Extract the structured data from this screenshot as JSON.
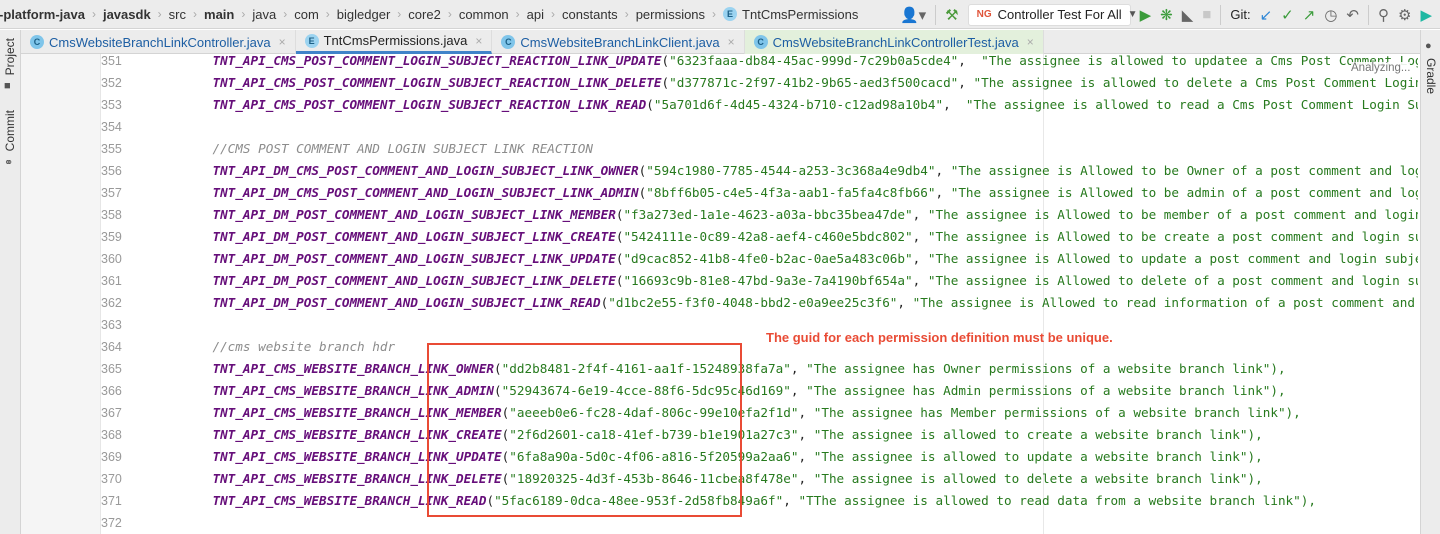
{
  "breadcrumb": [
    {
      "label": "-platform-java",
      "bold": true
    },
    {
      "label": "javasdk",
      "bold": true
    },
    {
      "label": "src"
    },
    {
      "label": "main",
      "bold": true
    },
    {
      "label": "java"
    },
    {
      "label": "com"
    },
    {
      "label": "bigledger"
    },
    {
      "label": "core2"
    },
    {
      "label": "common"
    },
    {
      "label": "api"
    },
    {
      "label": "constants"
    },
    {
      "label": "permissions"
    },
    {
      "label": "TntCmsPermissions",
      "icon": "E"
    }
  ],
  "toolbar": {
    "run_config": "Controller Test For All",
    "run_config_icon": "NG",
    "git_label": "Git:"
  },
  "side": {
    "project": "Project",
    "commit": "Commit",
    "gradle": "Gradle"
  },
  "tabs": [
    {
      "label": "CmsWebsiteBranchLinkController.java",
      "icon": "C"
    },
    {
      "label": "TntCmsPermissions.java",
      "icon": "E",
      "active": true
    },
    {
      "label": "CmsWebsiteBranchLinkClient.java",
      "icon": "C"
    },
    {
      "label": "CmsWebsiteBranchLinkControllerTest.java",
      "icon": "C"
    }
  ],
  "status": {
    "analyzing": "Analyzing..."
  },
  "annotation": {
    "text": "The guid for each permission definition must be unique.",
    "color": "#e94b35"
  },
  "lines": [
    {
      "n": "351",
      "name": "TNT_API_CMS_POST_COMMENT_LOGIN_SUBJECT_REACTION_LINK_UPDATE",
      "guid": "\"6323faaa-db84-45ac-999d-7c29b0a5cde4\"",
      "sep": ",  ",
      "desc": "\"The assignee is allowed to updatee a Cms Post Comment Login Subject"
    },
    {
      "n": "352",
      "name": "TNT_API_CMS_POST_COMMENT_LOGIN_SUBJECT_REACTION_LINK_DELETE",
      "guid": "\"d377871c-2f97-41b2-9b65-aed3f500cacd\"",
      "sep": ", ",
      "desc": "\"The assignee is allowed to delete a Cms Post Comment Login Subject"
    },
    {
      "n": "353",
      "name": "TNT_API_CMS_POST_COMMENT_LOGIN_SUBJECT_REACTION_LINK_READ",
      "guid": "\"5a701d6f-4d45-4324-b710-c12ad98a10b4\"",
      "sep": ",  ",
      "desc": "\"The assignee is allowed to read a Cms Post Comment Login Subject"
    },
    {
      "n": "354"
    },
    {
      "n": "355",
      "comment": "//CMS POST COMMENT AND LOGIN SUBJECT LINK REACTION"
    },
    {
      "n": "356",
      "name": "TNT_API_DM_CMS_POST_COMMENT_AND_LOGIN_SUBJECT_LINK_OWNER",
      "guid": "\"594c1980-7785-4544-a253-3c368a4e9db4\"",
      "sep": ", ",
      "desc": "\"The assignee is Allowed to be Owner of a post comment and login subject"
    },
    {
      "n": "357",
      "name": "TNT_API_DM_CMS_POST_COMMENT_AND_LOGIN_SUBJECT_LINK_ADMIN",
      "guid": "\"8bff6b05-c4e5-4f3a-aab1-fa5fa4c8fb66\"",
      "sep": ", ",
      "desc": "\"The assignee is Allowed to be admin of a post comment and login subject"
    },
    {
      "n": "358",
      "name": "TNT_API_DM_POST_COMMENT_AND_LOGIN_SUBJECT_LINK_MEMBER",
      "guid": "\"f3a273ed-1a1e-4623-a03a-bbc35bea47de\"",
      "sep": ", ",
      "desc": "\"The assignee is Allowed to be member of a post comment and login subject"
    },
    {
      "n": "359",
      "name": "TNT_API_DM_POST_COMMENT_AND_LOGIN_SUBJECT_LINK_CREATE",
      "guid": "\"5424111e-0c89-42a8-aef4-c460e5bdc802\"",
      "sep": ", ",
      "desc": "\"The assignee is Allowed to be create a post comment and login subject"
    },
    {
      "n": "360",
      "name": "TNT_API_DM_POST_COMMENT_AND_LOGIN_SUBJECT_LINK_UPDATE",
      "guid": "\"d9cac852-41b8-4fe0-b2ac-0ae5a483c06b\"",
      "sep": ", ",
      "desc": "\"The assignee is Allowed to update a post comment and login subject link"
    },
    {
      "n": "361",
      "name": "TNT_API_DM_POST_COMMENT_AND_LOGIN_SUBJECT_LINK_DELETE",
      "guid": "\"16693c9b-81e8-47bd-9a3e-7a4190bf654a\"",
      "sep": ", ",
      "desc": "\"The assignee is Allowed to delete of a post comment and login subject"
    },
    {
      "n": "362",
      "name": "TNT_API_DM_POST_COMMENT_AND_LOGIN_SUBJECT_LINK_READ",
      "guid": "\"d1bc2e55-f3f0-4048-bbd2-e0a9ee25c3f6\"",
      "sep": ", ",
      "desc": "\"The assignee is Allowed to read information of a post comment and login"
    },
    {
      "n": "363"
    },
    {
      "n": "364",
      "comment": "//cms website branch hdr"
    },
    {
      "n": "365",
      "name": "TNT_API_CMS_WEBSITE_BRANCH_LINK_OWNER",
      "guid": "\"dd2b8481-2f4f-4161-aa1f-15248938fa7a\"",
      "sep": ", ",
      "desc": "\"The assignee has Owner permissions of a website branch link\"),"
    },
    {
      "n": "366",
      "name": "TNT_API_CMS_WEBSITE_BRANCH_LINK_ADMIN",
      "guid": "\"52943674-6e19-4cce-88f6-5dc95c46d169\"",
      "sep": ", ",
      "desc": "\"The assignee has Admin permissions of a website branch link\"),"
    },
    {
      "n": "367",
      "name": "TNT_API_CMS_WEBSITE_BRANCH_LINK_MEMBER",
      "guid": "\"aeeeb0e6-fc28-4daf-806c-99e10efa2f1d\"",
      "sep": ", ",
      "desc": "\"The assignee has Member permissions of a website branch link\"),"
    },
    {
      "n": "368",
      "name": "TNT_API_CMS_WEBSITE_BRANCH_LINK_CREATE",
      "guid": "\"2f6d2601-ca18-41ef-b739-b1e1901a27c3\"",
      "sep": ", ",
      "desc": "\"The assignee is allowed to create a website branch link\"),"
    },
    {
      "n": "369",
      "name": "TNT_API_CMS_WEBSITE_BRANCH_LINK_UPDATE",
      "guid": "\"6fa8a90a-5d0c-4f06-a816-5f20599a2aa6\"",
      "sep": ", ",
      "desc": "\"The assignee is allowed to update a website branch link\"),"
    },
    {
      "n": "370",
      "name": "TNT_API_CMS_WEBSITE_BRANCH_LINK_DELETE",
      "guid": "\"18920325-4d3f-453b-8646-11cbea8f478e\"",
      "sep": ", ",
      "desc": "\"The assignee is allowed to delete a website branch link\"),"
    },
    {
      "n": "371",
      "name": "TNT_API_CMS_WEBSITE_BRANCH_LINK_READ",
      "guid": "\"5fac6189-0dca-48ee-953f-2d58fb849a6f\"",
      "sep": ", ",
      "desc": "\"TThe assignee is allowed to read data from a website branch link\"),"
    },
    {
      "n": "372"
    }
  ]
}
